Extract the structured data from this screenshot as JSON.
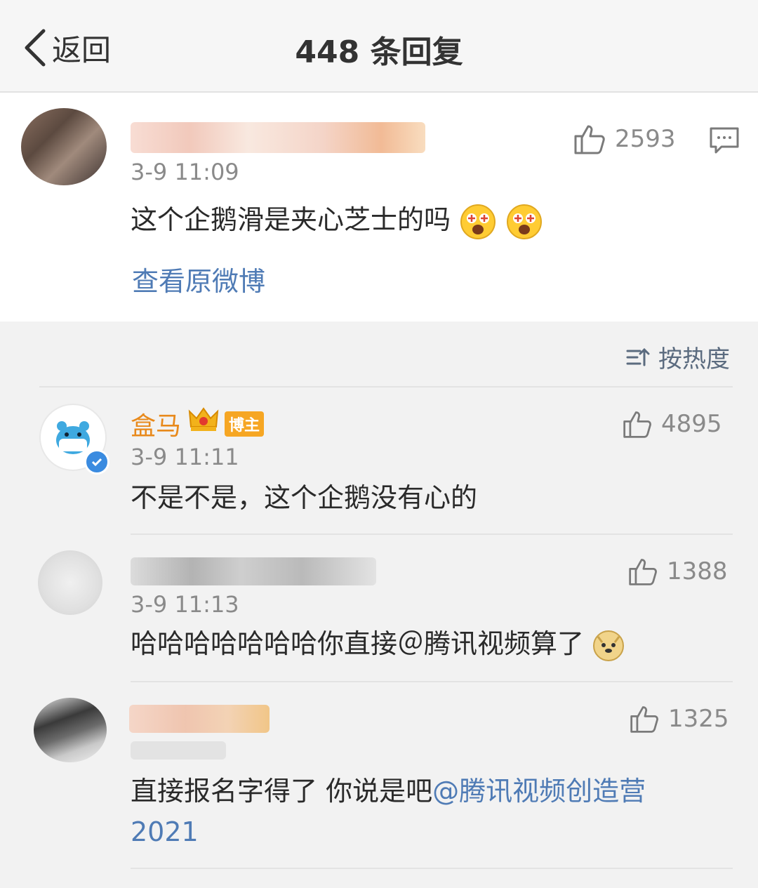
{
  "nav": {
    "back_label": "返回",
    "title": "448 条回复"
  },
  "root_comment": {
    "time": "3-9 11:09",
    "content": "这个企鹅滑是夹心芝士的吗",
    "likes": "2593",
    "view_original": "查看原微博",
    "emoji": [
      "star-eyes-emoji",
      "star-eyes-emoji"
    ]
  },
  "sort": {
    "label": "按热度"
  },
  "replies": [
    {
      "username": "盒马",
      "badge": "博主",
      "time": "3-9 11:11",
      "content": "不是不是，这个企鹅没有心的",
      "likes": "4895"
    },
    {
      "time": "3-9 11:13",
      "content": "哈哈哈哈哈哈哈你直接＠腾讯视频算了",
      "likes": "1388",
      "emoji": "doge-emoji"
    },
    {
      "content_text": "直接报名字得了  你说是吧",
      "mention": "@腾讯视频创造营2021",
      "likes": "1325"
    }
  ],
  "colors": {
    "link": "#4f7bb5",
    "username_vip": "#e8891b",
    "verified": "#3a8be0"
  }
}
